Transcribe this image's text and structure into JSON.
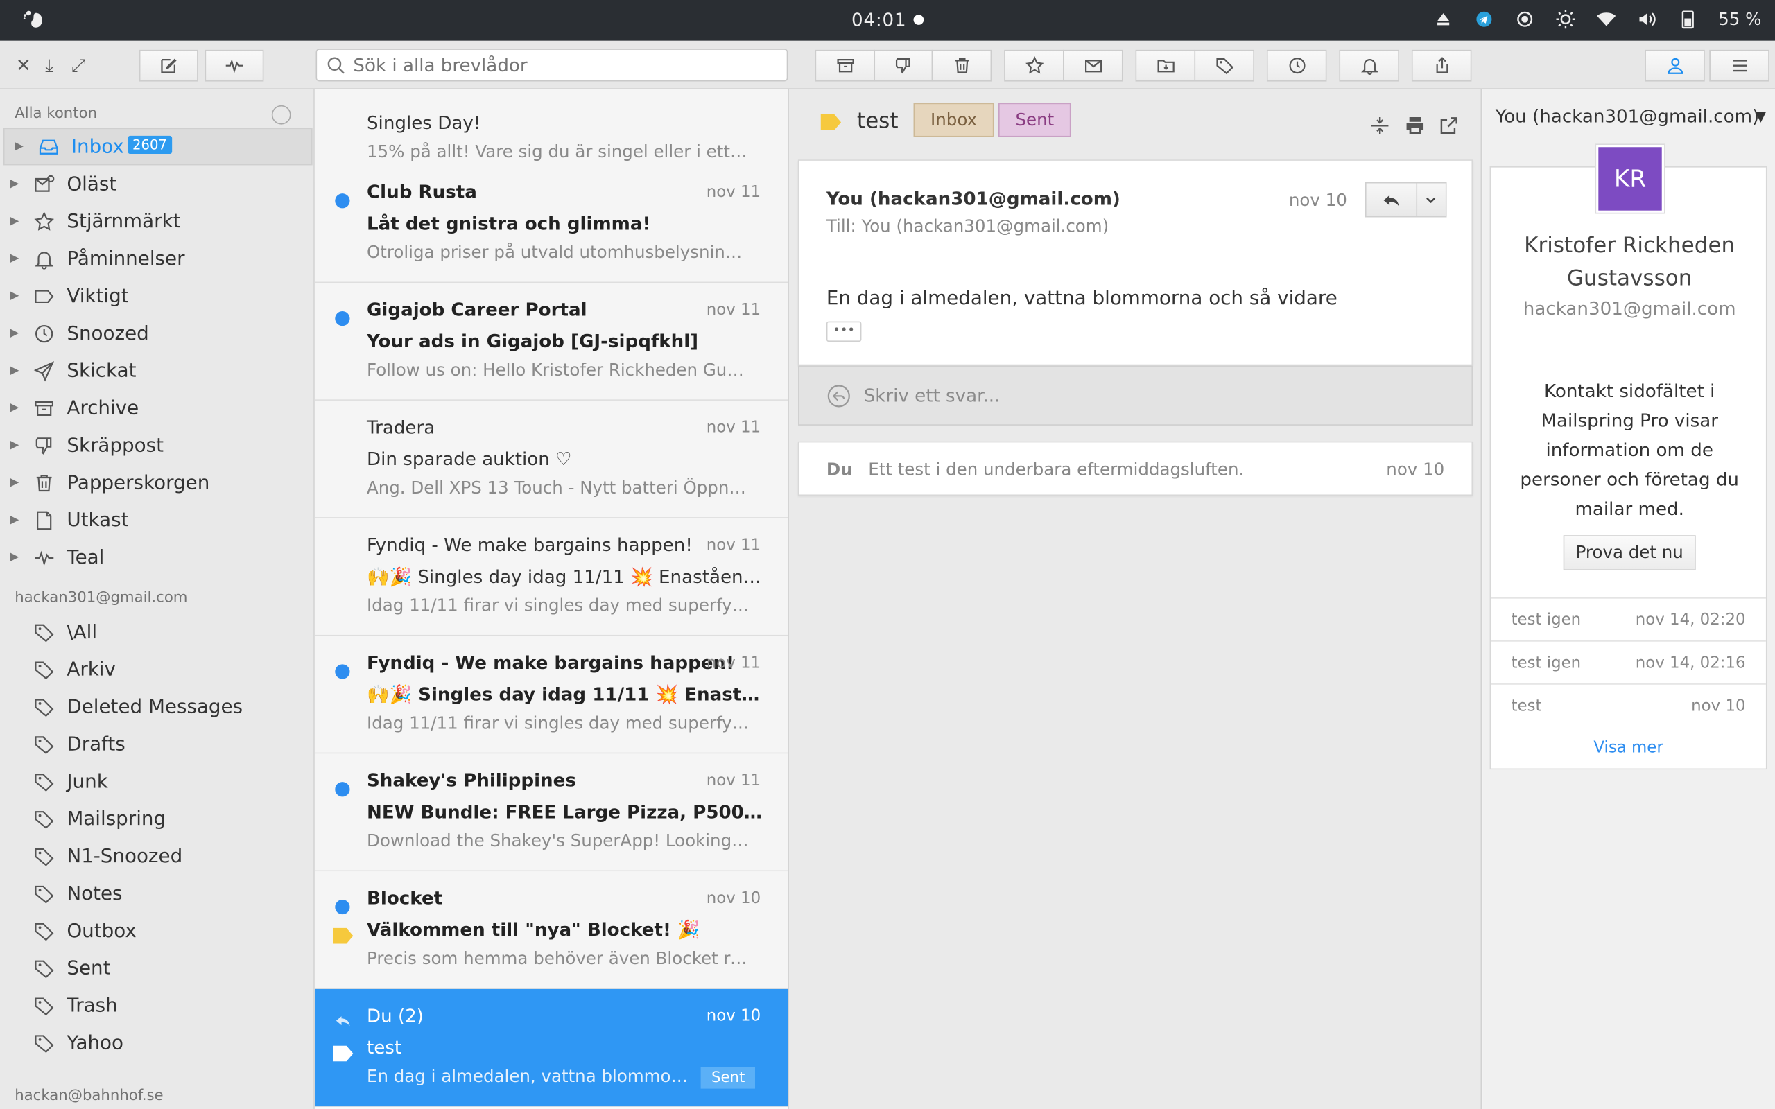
{
  "topbar": {
    "clock": "04:01",
    "battery": "55 %"
  },
  "search": {
    "placeholder": "Sök i alla brevlådor"
  },
  "sidebar": {
    "header": "Alla konton",
    "items": [
      {
        "label": "Inbox",
        "badge": "2607",
        "icon": "inbox-icon"
      },
      {
        "label": "Oläst",
        "icon": "unread-icon"
      },
      {
        "label": "Stjärnmärkt",
        "icon": "star-icon"
      },
      {
        "label": "Påminnelser",
        "icon": "bell-icon"
      },
      {
        "label": "Viktigt",
        "icon": "label-icon"
      },
      {
        "label": "Snoozed",
        "icon": "clock-icon"
      },
      {
        "label": "Skickat",
        "icon": "send-icon"
      },
      {
        "label": "Archive",
        "icon": "archive-icon"
      },
      {
        "label": "Skräppost",
        "icon": "spam-icon"
      },
      {
        "label": "Papperskorgen",
        "icon": "trash-icon"
      },
      {
        "label": "Utkast",
        "icon": "draft-icon"
      },
      {
        "label": "Teal",
        "icon": "activity-icon"
      }
    ],
    "account1": "hackan301@gmail.com",
    "folders": [
      "\\All",
      "Arkiv",
      "Deleted Messages",
      "Drafts",
      "Junk",
      "Mailspring",
      "N1-Snoozed",
      "Notes",
      "Outbox",
      "Sent",
      "Trash",
      "Yahoo"
    ],
    "account2": "hackan@bahnhof.se"
  },
  "messages": [
    {
      "from": "",
      "date": "",
      "subject": "Singles Day!",
      "snippet": "15% på allt! Vare sig du är singel eller i ett förh...",
      "unread": false
    },
    {
      "from": "Club Rusta",
      "date": "nov 11",
      "subject": "Låt det gnistra och glimma!",
      "snippet": "Otroliga priser på utvald utomhusbelysning, a...",
      "unread": true
    },
    {
      "from": "Gigajob Career Portal",
      "date": "nov 11",
      "subject": "Your ads in Gigajob [GJ-sipqfkhl]",
      "snippet": "Follow us on: Hello Kristofer Rickheden Gusta...",
      "unread": true
    },
    {
      "from": "Tradera",
      "date": "nov 11",
      "subject": "Din sparade auktion ♡",
      "snippet": "Ang. Dell XPS 13 Touch - Nytt batteri Öppna i ...",
      "unread": false
    },
    {
      "from": "Fyndiq - We make bargains happen!",
      "date": "nov 11",
      "subject": "🙌🎉 Singles day idag 11/11 💥 Enastående ...",
      "snippet": "Idag 11/11 firar vi singles day med superfynd ...",
      "unread": false
    },
    {
      "from": "Fyndiq - We make bargains happen!",
      "date": "nov 11",
      "subject": "🙌🎉 Singles day idag 11/11 💥 Enastående...",
      "snippet": "Idag 11/11 firar vi singles day med superfynd ...",
      "unread": true
    },
    {
      "from": "Shakey's Philippines",
      "date": "nov 11",
      "subject": "NEW Bundle: FREE Large Pizza, P500 GC...",
      "snippet": "Download the Shakey's SuperApp! Looking fo...",
      "unread": true
    },
    {
      "from": "Blocket",
      "date": "nov 10",
      "subject": "Välkommen till \"nya\" Blocket! 🎉",
      "snippet": "Precis som hemma behöver även Blocket ren...",
      "unread": true
    },
    {
      "from": "Du (2)",
      "date": "nov 10",
      "subject": "test",
      "snippet": "En dag i almedalen, vattna blommorna ...",
      "unread": false,
      "pill": "Sent"
    }
  ],
  "reader": {
    "subject": "test",
    "labels": [
      "Inbox",
      "Sent"
    ],
    "message": {
      "sender": "You (hackan301@gmail.com)",
      "to": "Till: You (hackan301@gmail.com)",
      "date": "nov 10",
      "body": "En dag i almedalen, vattna blommorna och så vidare",
      "more": "•••"
    },
    "reply_placeholder": "Skriv ett svar...",
    "collapsed": {
      "who": "Du",
      "text": "Ett test i den underbara eftermiddagsluften.",
      "date": "nov 10"
    }
  },
  "contact": {
    "account_select": "You (hackan301@gmail.com)",
    "initials": "KR",
    "name": "Kristofer Rickheden Gustavsson",
    "email": "hackan301@gmail.com",
    "promo": "Kontakt sidofältet i Mailspring Pro visar information om de personer och företag du mailar med.",
    "try_button": "Prova det nu",
    "threads": [
      {
        "subject": "test igen",
        "date": "nov 14, 02:20"
      },
      {
        "subject": "test igen",
        "date": "nov 14, 02:16"
      },
      {
        "subject": "test",
        "date": "nov 10"
      }
    ],
    "show_more": "Visa mer"
  },
  "colors": {
    "accent": "#2f97f4",
    "avatar": "#7d4bc2",
    "topbar": "#2a2e33"
  }
}
